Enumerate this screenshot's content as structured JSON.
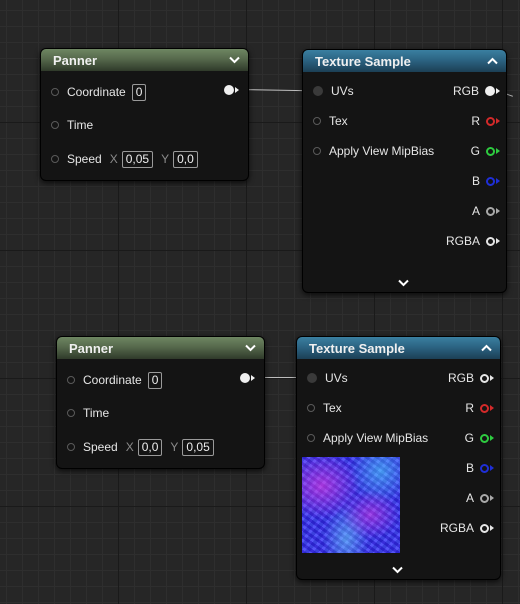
{
  "panner_top": {
    "title": "Panner",
    "coordinate_label": "Coordinate",
    "coordinate_value": "0",
    "time_label": "Time",
    "speed_label": "Speed",
    "x_label": "X",
    "speed_x": "0,05",
    "y_label": "Y",
    "speed_y": "0,0"
  },
  "texture_top": {
    "title": "Texture Sample",
    "inputs": [
      "UVs",
      "Tex",
      "Apply View MipBias"
    ],
    "outputs": [
      "RGB",
      "R",
      "G",
      "B",
      "A",
      "RGBA"
    ]
  },
  "panner_bottom": {
    "title": "Panner",
    "coordinate_label": "Coordinate",
    "coordinate_value": "0",
    "time_label": "Time",
    "speed_label": "Speed",
    "x_label": "X",
    "speed_x": "0,0",
    "y_label": "Y",
    "speed_y": "0,05"
  },
  "texture_bottom": {
    "title": "Texture Sample",
    "inputs": [
      "UVs",
      "Tex",
      "Apply View MipBias"
    ],
    "outputs": [
      "RGB",
      "R",
      "G",
      "B",
      "A",
      "RGBA"
    ]
  },
  "colors": {
    "r_pin": "#d42a2a",
    "g_pin": "#2ecc40",
    "b_pin": "#1f2fd8",
    "grey_pin": "#a9a9a9",
    "panner_header": "#56694c",
    "texture_header": "#2c6483"
  },
  "icons": {
    "collapse": "chevron-down-icon",
    "expand_collapse_texture": "chevron-up-icon",
    "advanced": "chevron-down-icon"
  }
}
